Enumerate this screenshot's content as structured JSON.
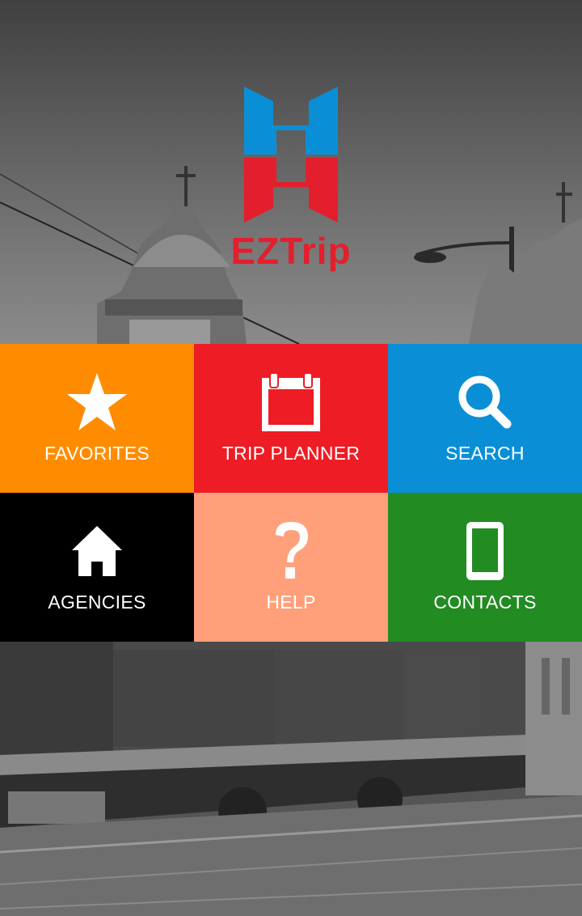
{
  "app": {
    "name": "EZTrip"
  },
  "colors": {
    "favorites": "#ff8c00",
    "trip_planner": "#ee1c25",
    "search": "#0a8fd6",
    "agencies": "#000000",
    "help": "#ffa07a",
    "contacts": "#228b22",
    "logo_blue": "#0a8fd6",
    "logo_red": "#e31e2d"
  },
  "menu": {
    "favorites": {
      "label": "FAVORITES",
      "icon": "star-icon"
    },
    "trip_planner": {
      "label": "TRIP PLANNER",
      "icon": "calendar-icon"
    },
    "search": {
      "label": "SEARCH",
      "icon": "search-icon"
    },
    "agencies": {
      "label": "AGENCIES",
      "icon": "home-icon"
    },
    "help": {
      "label": "HELP",
      "icon": "question-icon"
    },
    "contacts": {
      "label": "CONTACTS",
      "icon": "phone-icon"
    }
  }
}
